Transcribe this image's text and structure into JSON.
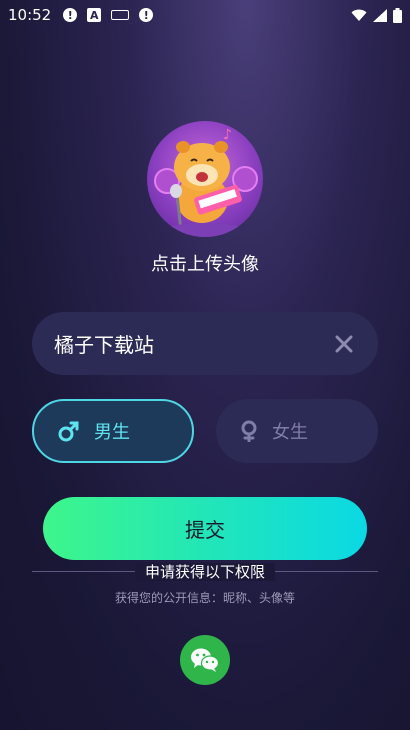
{
  "status_bar": {
    "time": "10:52",
    "icons": [
      "alert-icon",
      "a-icon",
      "keyboard-icon",
      "alert-icon",
      "wifi-icon",
      "signal-icon",
      "battery-icon"
    ]
  },
  "avatar": {
    "caption": "点击上传头像",
    "icon": "singing-hamster-avatar"
  },
  "name_field": {
    "value": "橘子下载站",
    "clear_icon": "close-icon"
  },
  "gender": {
    "male_label": "男生",
    "female_label": "女生",
    "selected": "male",
    "male_color": "#5ee4f0",
    "female_color": "#7f7ea6"
  },
  "submit": {
    "label": "提交",
    "gradient_start": "#3ef68a",
    "gradient_end": "#0ad9e4"
  },
  "permissions": {
    "title": "申请获得以下权限",
    "description": "获得您的公开信息：昵称、头像等"
  },
  "login": {
    "wechat_icon": "wechat-icon",
    "wechat_color": "#2fb54a"
  }
}
